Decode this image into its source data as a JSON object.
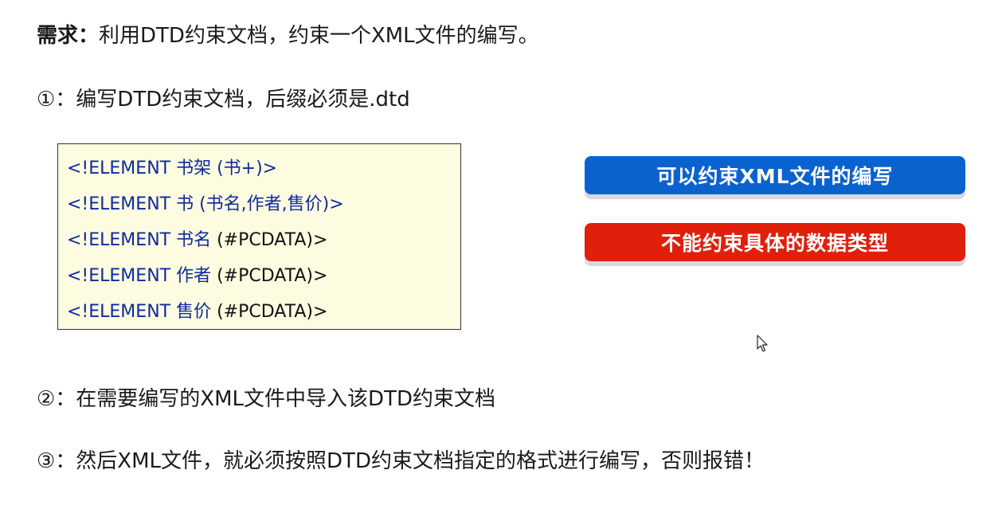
{
  "requirement": {
    "label": "需求：",
    "text": "利用DTD约束文档，约束一个XML文件的编写。"
  },
  "steps": [
    "①：编写DTD约束文档，后缀必须是.dtd",
    "②：在需要编写的XML文件中导入该DTD约束文档",
    "③：然后XML文件，就必须按照DTD约束文档指定的格式进行编写，否则报错！"
  ],
  "dtd_code": [
    {
      "decl": "<!ELEMENT 书架 (书+)>"
    },
    {
      "decl": "<!ELEMENT 书 (书名,作者,售价)>"
    },
    {
      "prefix": "<!ELEMENT 书名 ",
      "suffix": "(#PCDATA)>"
    },
    {
      "prefix": "<!ELEMENT 作者 ",
      "suffix": "(#PCDATA)>"
    },
    {
      "prefix": "<!ELEMENT 售价 ",
      "suffix": "(#PCDATA)>"
    }
  ],
  "callouts": {
    "can": "可以约束XML文件的编写",
    "cannot": "不能约束具体的数据类型"
  },
  "colors": {
    "code_text": "#0e2aa0",
    "code_bg": "#fefce0",
    "callout_blue": "#0a62cf",
    "callout_red": "#e0200b"
  },
  "icons": [
    "mouse-cursor-icon"
  ]
}
